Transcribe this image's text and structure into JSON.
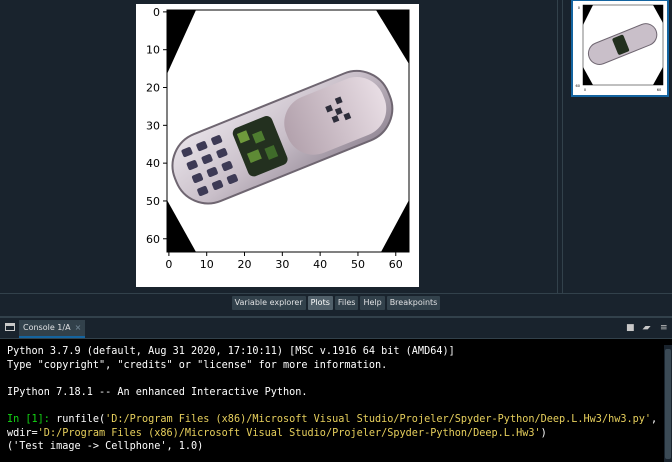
{
  "plot": {
    "y_ticks": [
      "0",
      "10",
      "20",
      "30",
      "40",
      "50",
      "60"
    ],
    "x_ticks": [
      "0",
      "10",
      "20",
      "30",
      "40",
      "50",
      "60"
    ]
  },
  "pane_tabs": [
    "Variable explorer",
    "Plots",
    "Files",
    "Help",
    "Breakpoints"
  ],
  "active_pane_tab": "Plots",
  "console": {
    "tab_label": "Console 1/A",
    "tab_close": "×",
    "lines": {
      "l1": "Python 3.7.9 (default, Aug 31 2020, 17:10:11) [MSC v.1916 64 bit (AMD64)]",
      "l2": "Type \"copyright\", \"credits\" or \"license\" for more information.",
      "l3": "IPython 7.18.1 -- An enhanced Interactive Python.",
      "prompt": "In [1]:",
      "cmd_pre": " runfile(",
      "cmd_str1": "'D:/Program Files (x86)/Microsoft Visual Studio/Projeler/Spyder-Python/Deep.L.Hw3/hw3.py'",
      "cmd_mid": ",",
      "wdir_pre": "wdir=",
      "wdir_str": "'D:/Program Files (x86)/Microsoft Visual Studio/Projeler/Spyder-Python/Deep.L.Hw3'",
      "wdir_post": ")",
      "result": "('Test image -> Cellphone', 1.0)"
    }
  },
  "icons": {
    "console_window": "console-window-icon",
    "stop": "stop-square-icon",
    "clear": "eraser-icon",
    "options": "hamburger-menu-icon"
  },
  "colors": {
    "background": "#19232d",
    "border": "#32414b",
    "accent": "#1464a0",
    "prompt": "#14d414",
    "string": "#e6cf5c"
  }
}
